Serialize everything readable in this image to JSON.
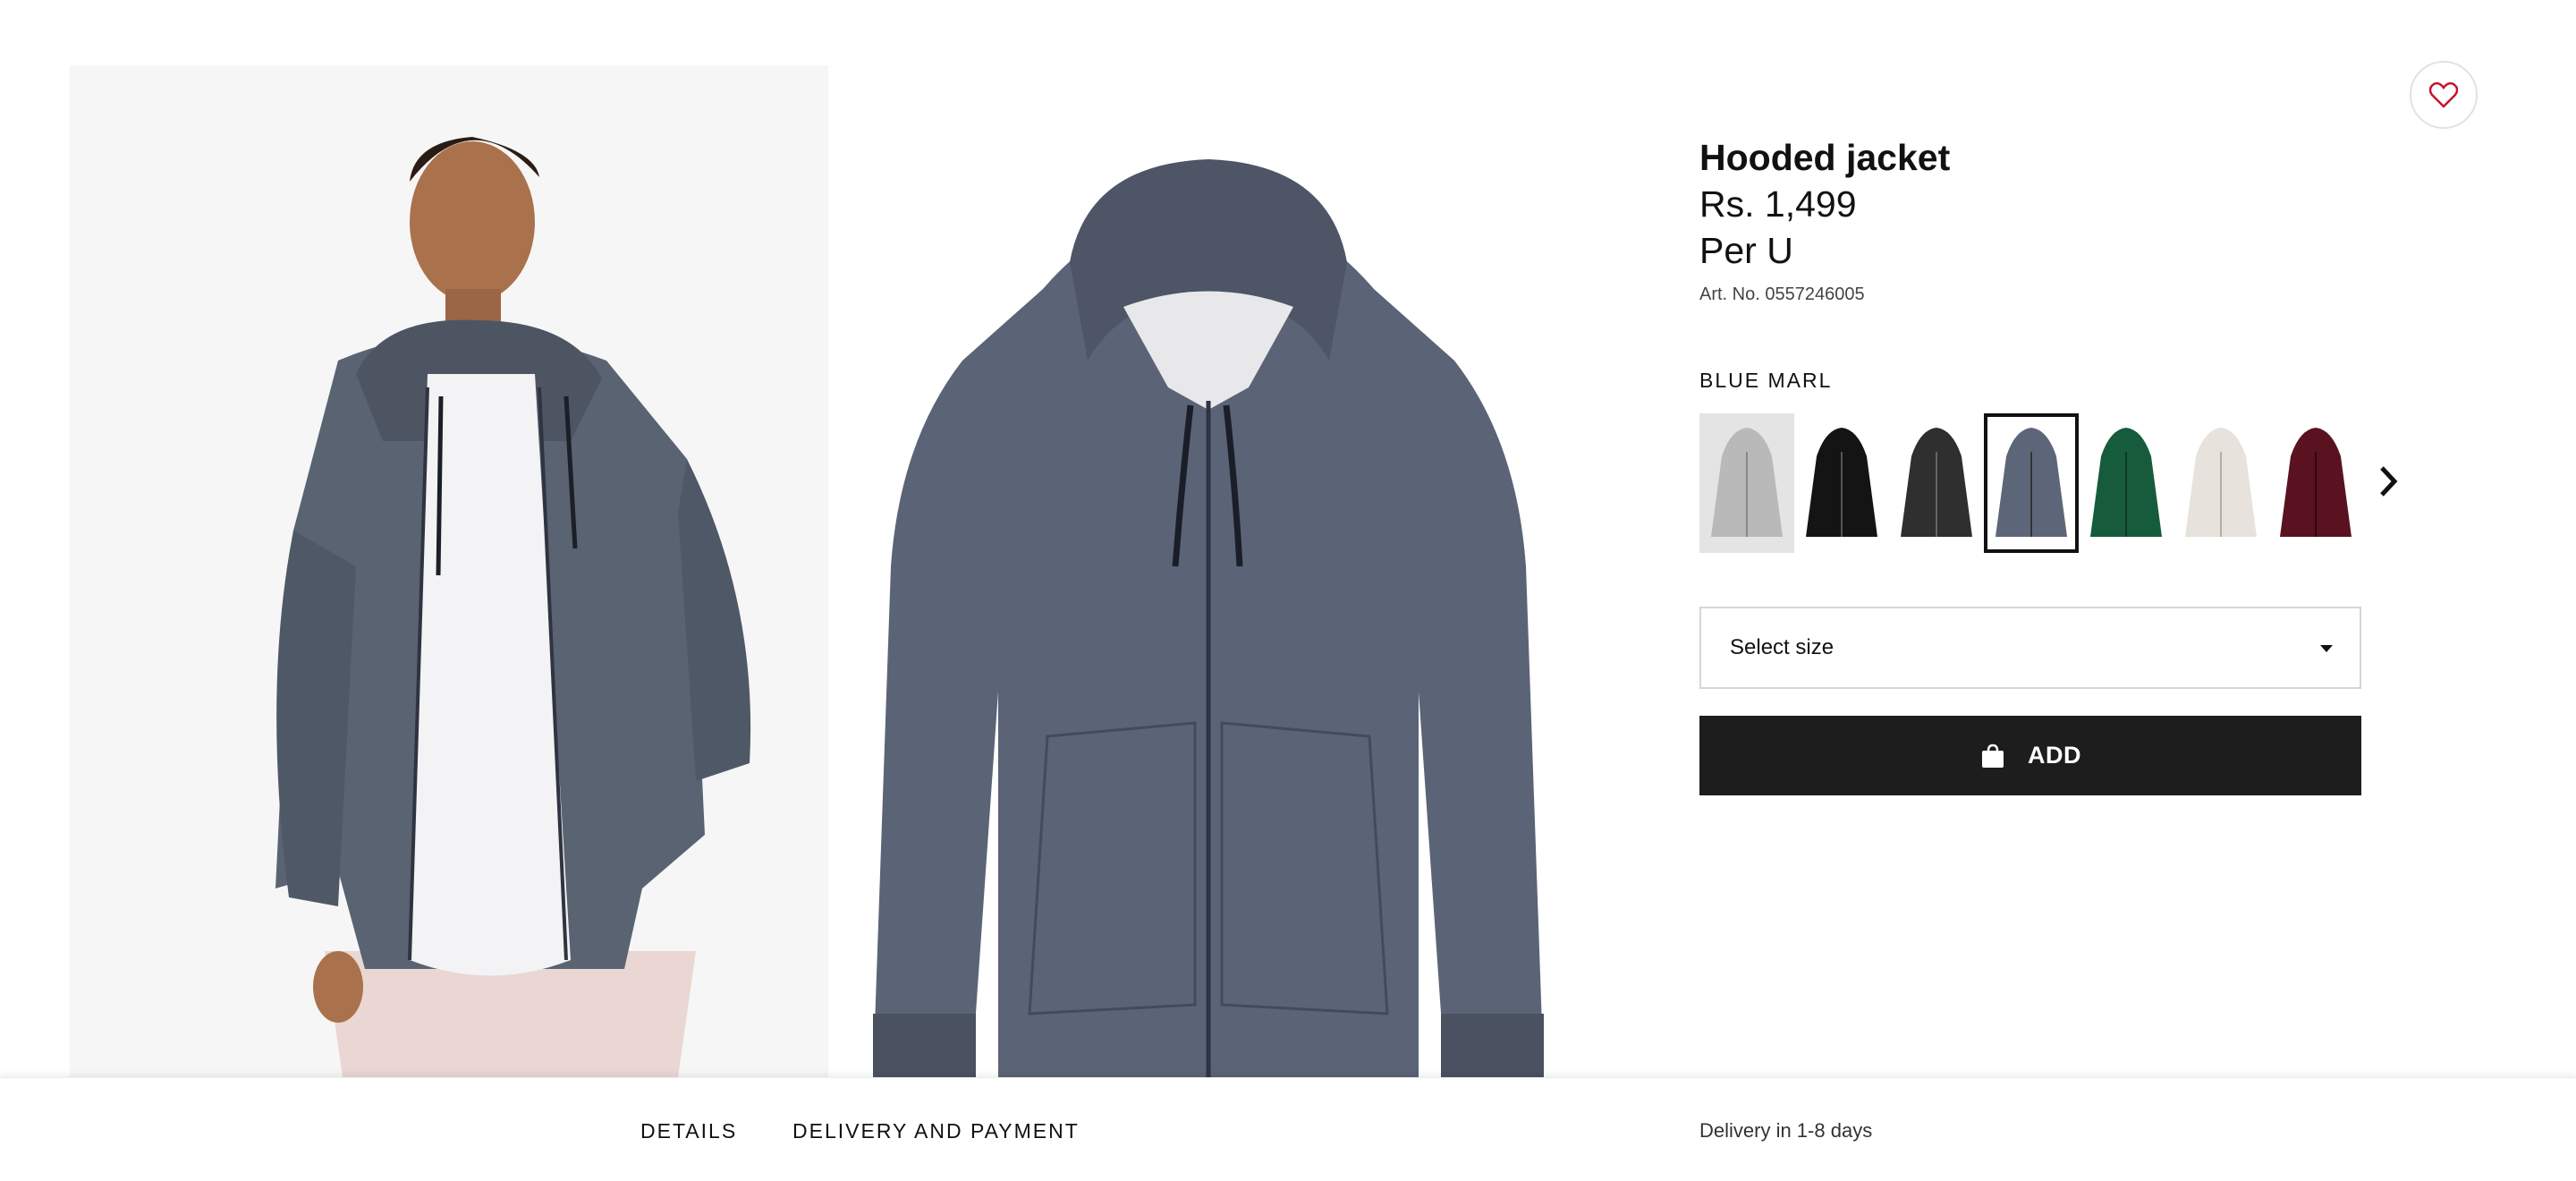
{
  "product": {
    "title": "Hooded jacket",
    "price": "Rs. 1,499",
    "unit": "Per U",
    "art_no": "Art. No. 0557246005"
  },
  "color": {
    "selected_name": "BLUE MARL",
    "swatches": [
      {
        "name": "light-grey",
        "color": "#b9b9b9"
      },
      {
        "name": "black",
        "color": "#141414"
      },
      {
        "name": "dark-grey",
        "color": "#2f2f2f"
      },
      {
        "name": "blue-marl",
        "color": "#5d6678"
      },
      {
        "name": "dark-green",
        "color": "#165c3c"
      },
      {
        "name": "light-beige",
        "color": "#e8e2dc"
      },
      {
        "name": "burgundy",
        "color": "#5a1220"
      }
    ]
  },
  "size_select": {
    "label": "Select size"
  },
  "add_button": {
    "label": "ADD"
  },
  "bottom_bar": {
    "tab_details": "DETAILS",
    "tab_delivery": "DELIVERY AND PAYMENT",
    "delivery_info": "Delivery in 1-8 days"
  },
  "icons": {
    "favorite": "heart-icon",
    "bag": "shopping-bag-icon",
    "next": "chevron-right-icon",
    "dropdown": "caret-down-icon"
  },
  "colors": {
    "accent_heart": "#c8102e",
    "button_bg": "#1d1d1d"
  }
}
